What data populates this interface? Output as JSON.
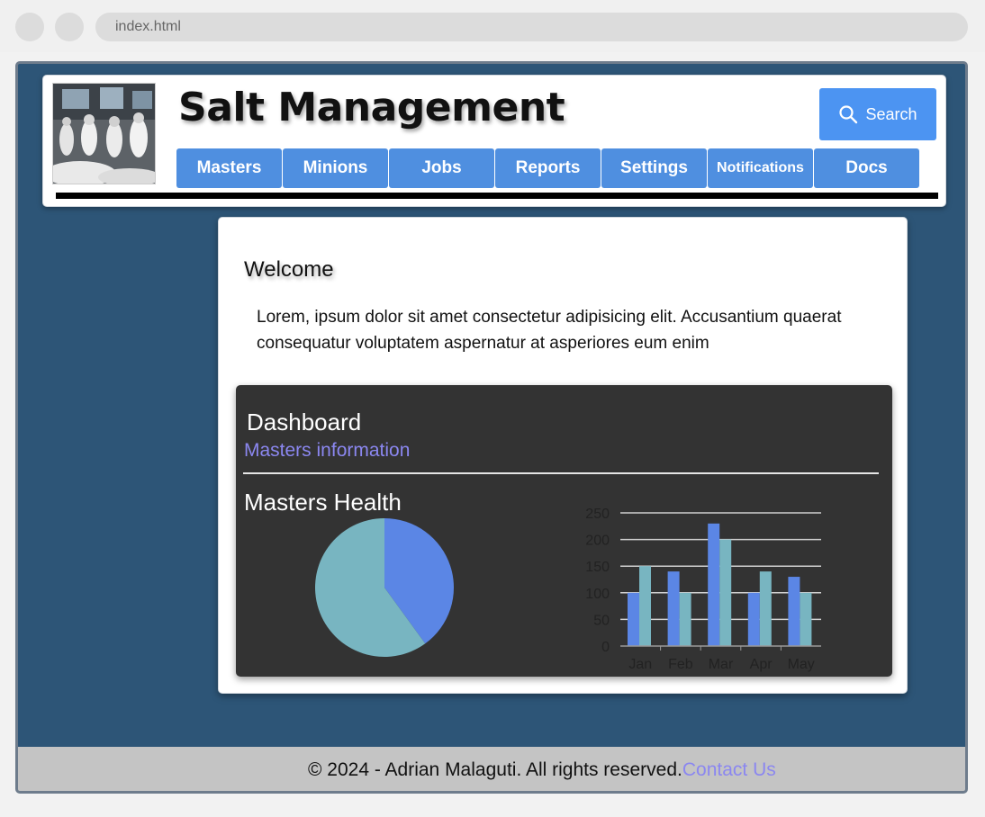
{
  "browser": {
    "url": "index.html"
  },
  "header": {
    "title": "Salt Management",
    "search_label": "Search",
    "nav": [
      "Masters",
      "Minions",
      "Jobs",
      "Reports",
      "Settings",
      "Notifications",
      "Docs"
    ]
  },
  "welcome": {
    "title": "Welcome",
    "text": "Lorem, ipsum dolor sit amet consectetur adipisicing elit. Accusantium quaerat consequatur voluptatem aspernatur at asperiores eum enim"
  },
  "dashboard": {
    "title": "Dashboard",
    "subtitle": "Masters information",
    "health_title": "Masters Health"
  },
  "chart_data": [
    {
      "type": "pie",
      "values": [
        40,
        60
      ],
      "colors": [
        "#5b86e5",
        "#78b5c1"
      ]
    },
    {
      "type": "bar",
      "categories": [
        "Jan",
        "Feb",
        "Mar",
        "Apr",
        "May"
      ],
      "series": [
        {
          "values": [
            100,
            140,
            230,
            100,
            130
          ],
          "color": "#5b86e5"
        },
        {
          "values": [
            150,
            100,
            200,
            140,
            100
          ],
          "color": "#78b5c1"
        }
      ],
      "ylim": [
        0,
        250
      ],
      "yticks": [
        0,
        50,
        100,
        150,
        200,
        250
      ],
      "grid": true
    }
  ],
  "footer": {
    "copyright": "© 2024 - Adrian Malaguti. All rights reserved.",
    "contact_label": "Contact Us"
  },
  "colors": {
    "page_bg": "#2d5577",
    "accent": "#4f8fe0",
    "link": "#8b87f0",
    "panel": "#333333"
  }
}
